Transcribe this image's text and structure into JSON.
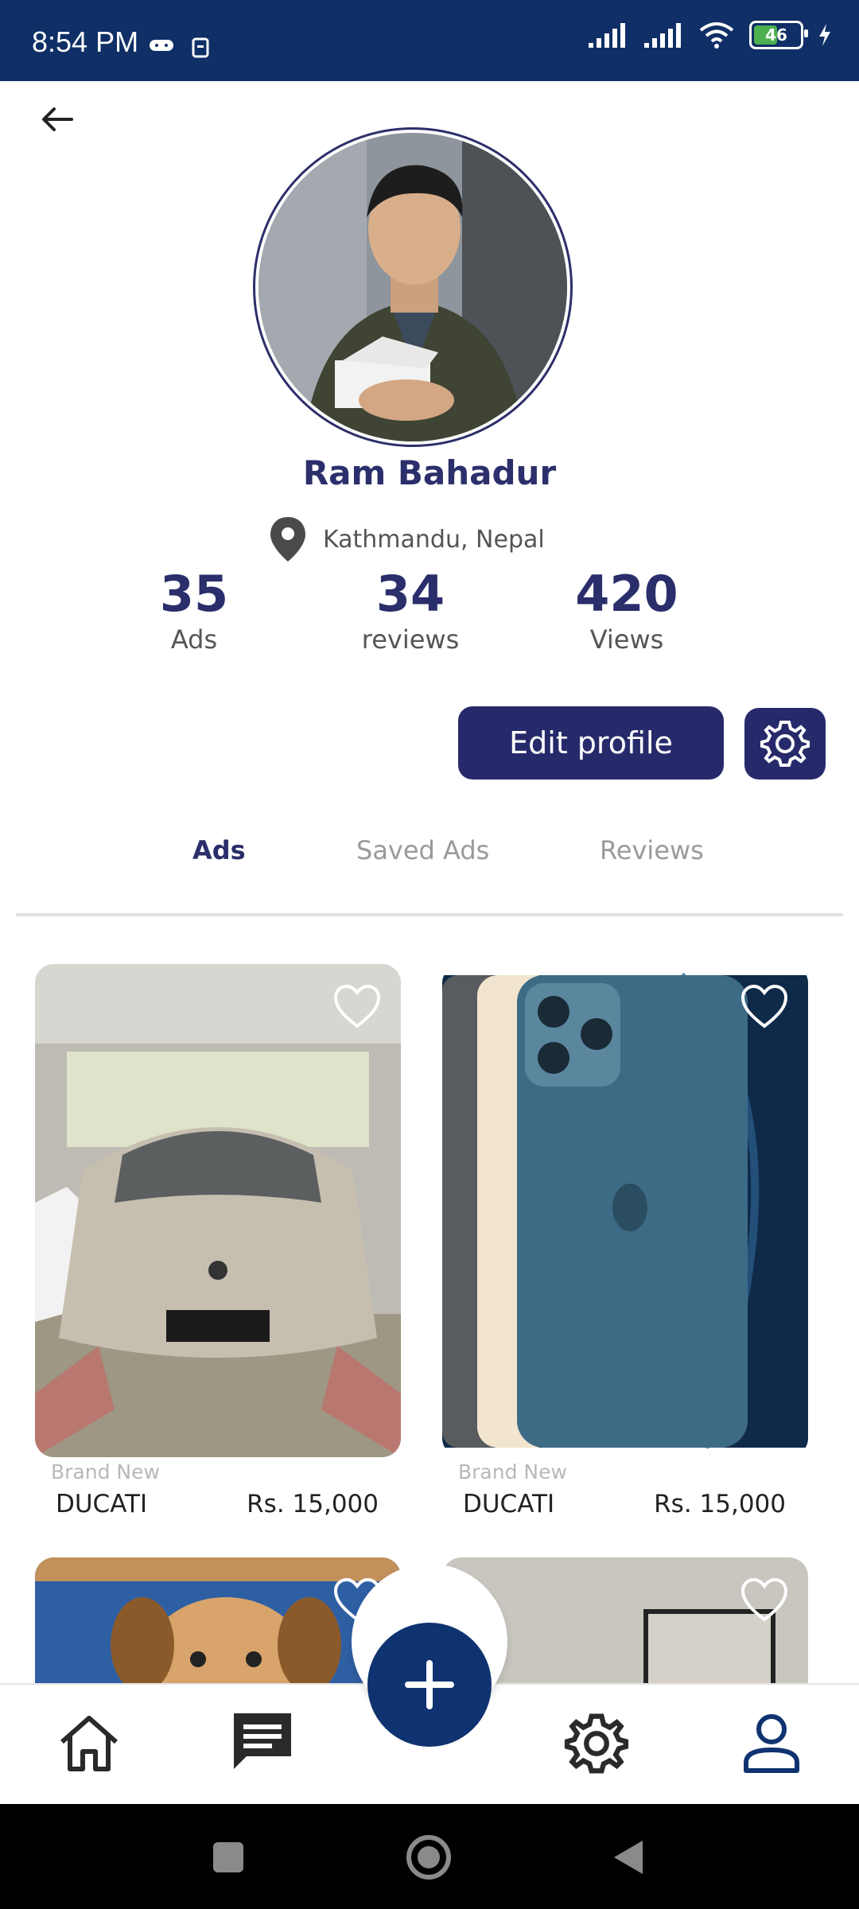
{
  "status_bar": {
    "time": "8:54 PM",
    "battery_level": "46",
    "icons": [
      "game-icon",
      "notification-icon",
      "signal-icon",
      "signal-icon",
      "wifi-icon",
      "battery-icon",
      "charging-icon"
    ]
  },
  "profile": {
    "name": "Ram Bahadur",
    "location": "Kathmandu, Nepal",
    "stats": [
      {
        "value": "35",
        "label": "Ads"
      },
      {
        "value": "34",
        "label": "reviews"
      },
      {
        "value": "420",
        "label": "Views"
      }
    ],
    "edit_label": "Edit profile"
  },
  "tabs": [
    "Ads",
    "Saved Ads",
    "Reviews"
  ],
  "active_tab": "Ads",
  "ads": [
    {
      "condition": "Brand New",
      "title": "DUCATI",
      "price": "Rs. 15,000"
    },
    {
      "condition": "Brand New",
      "title": "DUCATI",
      "price": "Rs. 15,000"
    }
  ],
  "colors": {
    "primary": "#272a6a",
    "status_bar": "#0f2f66",
    "fab": "#0f3370"
  }
}
